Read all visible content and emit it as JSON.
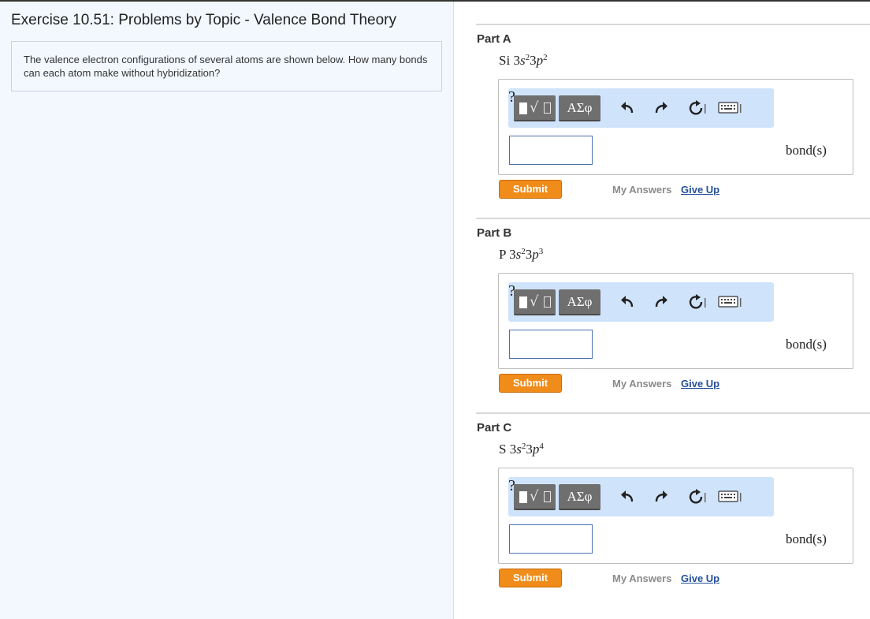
{
  "exercise": {
    "title": "Exercise 10.51: Problems by Topic - Valence Bond Theory",
    "intro": "The valence electron configurations of several atoms are shown below. How many bonds can each atom make without hybridization?"
  },
  "toolbar": {
    "greek_label": "ΑΣφ",
    "help_label": "?"
  },
  "parts": [
    {
      "label": "Part A",
      "element": "Si",
      "orbital1_n": "3",
      "orbital1_l": "s",
      "orbital1_exp": "2",
      "orbital2_n": "3",
      "orbital2_l": "p",
      "orbital2_exp": "2",
      "answer_value": "",
      "unit": "bond(s)",
      "submit_label": "Submit",
      "my_answers_label": "My Answers",
      "give_up_label": "Give Up"
    },
    {
      "label": "Part B",
      "element": "P",
      "orbital1_n": "3",
      "orbital1_l": "s",
      "orbital1_exp": "2",
      "orbital2_n": "3",
      "orbital2_l": "p",
      "orbital2_exp": "3",
      "answer_value": "",
      "unit": "bond(s)",
      "submit_label": "Submit",
      "my_answers_label": "My Answers",
      "give_up_label": "Give Up"
    },
    {
      "label": "Part C",
      "element": "S",
      "orbital1_n": "3",
      "orbital1_l": "s",
      "orbital1_exp": "2",
      "orbital2_n": "3",
      "orbital2_l": "p",
      "orbital2_exp": "4",
      "answer_value": "",
      "unit": "bond(s)",
      "submit_label": "Submit",
      "my_answers_label": "My Answers",
      "give_up_label": "Give Up"
    }
  ],
  "colors": {
    "submit": "#f08c1a",
    "toolbar_bg": "#cfe3fb",
    "link": "#24509a",
    "left_pane_bg": "#f3f8ff"
  },
  "icons": [
    "templates-icon",
    "undo-icon",
    "redo-icon",
    "reset-icon",
    "keyboard-icon",
    "help-icon"
  ]
}
